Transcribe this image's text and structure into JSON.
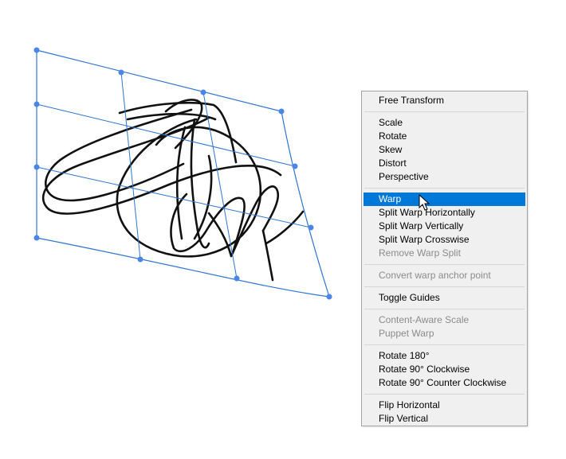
{
  "colors": {
    "handle": "#4a86e8",
    "grid_line": "#2f74d0",
    "menu_background": "#f0f0f0",
    "menu_border": "#a3a3a3",
    "selected_background": "#0078d7",
    "disabled_text": "#8b8b8b"
  },
  "canvas": {
    "artwork": "handwritten-signature",
    "mode": "warp"
  },
  "context_menu": {
    "groups": [
      [
        {
          "label": "Free Transform",
          "enabled": true
        }
      ],
      [
        {
          "label": "Scale",
          "enabled": true
        },
        {
          "label": "Rotate",
          "enabled": true
        },
        {
          "label": "Skew",
          "enabled": true
        },
        {
          "label": "Distort",
          "enabled": true
        },
        {
          "label": "Perspective",
          "enabled": true
        }
      ],
      [
        {
          "label": "Warp",
          "enabled": true,
          "selected": true
        },
        {
          "label": "Split Warp Horizontally",
          "enabled": true
        },
        {
          "label": "Split Warp Vertically",
          "enabled": true
        },
        {
          "label": "Split Warp Crosswise",
          "enabled": true
        },
        {
          "label": "Remove Warp Split",
          "enabled": false
        }
      ],
      [
        {
          "label": "Convert warp anchor point",
          "enabled": false
        }
      ],
      [
        {
          "label": "Toggle Guides",
          "enabled": true
        }
      ],
      [
        {
          "label": "Content-Aware Scale",
          "enabled": false
        },
        {
          "label": "Puppet Warp",
          "enabled": false
        }
      ],
      [
        {
          "label": "Rotate 180°",
          "enabled": true
        },
        {
          "label": "Rotate 90° Clockwise",
          "enabled": true
        },
        {
          "label": "Rotate 90° Counter Clockwise",
          "enabled": true
        }
      ],
      [
        {
          "label": "Flip Horizontal",
          "enabled": true
        },
        {
          "label": "Flip Vertical",
          "enabled": true
        }
      ]
    ]
  }
}
